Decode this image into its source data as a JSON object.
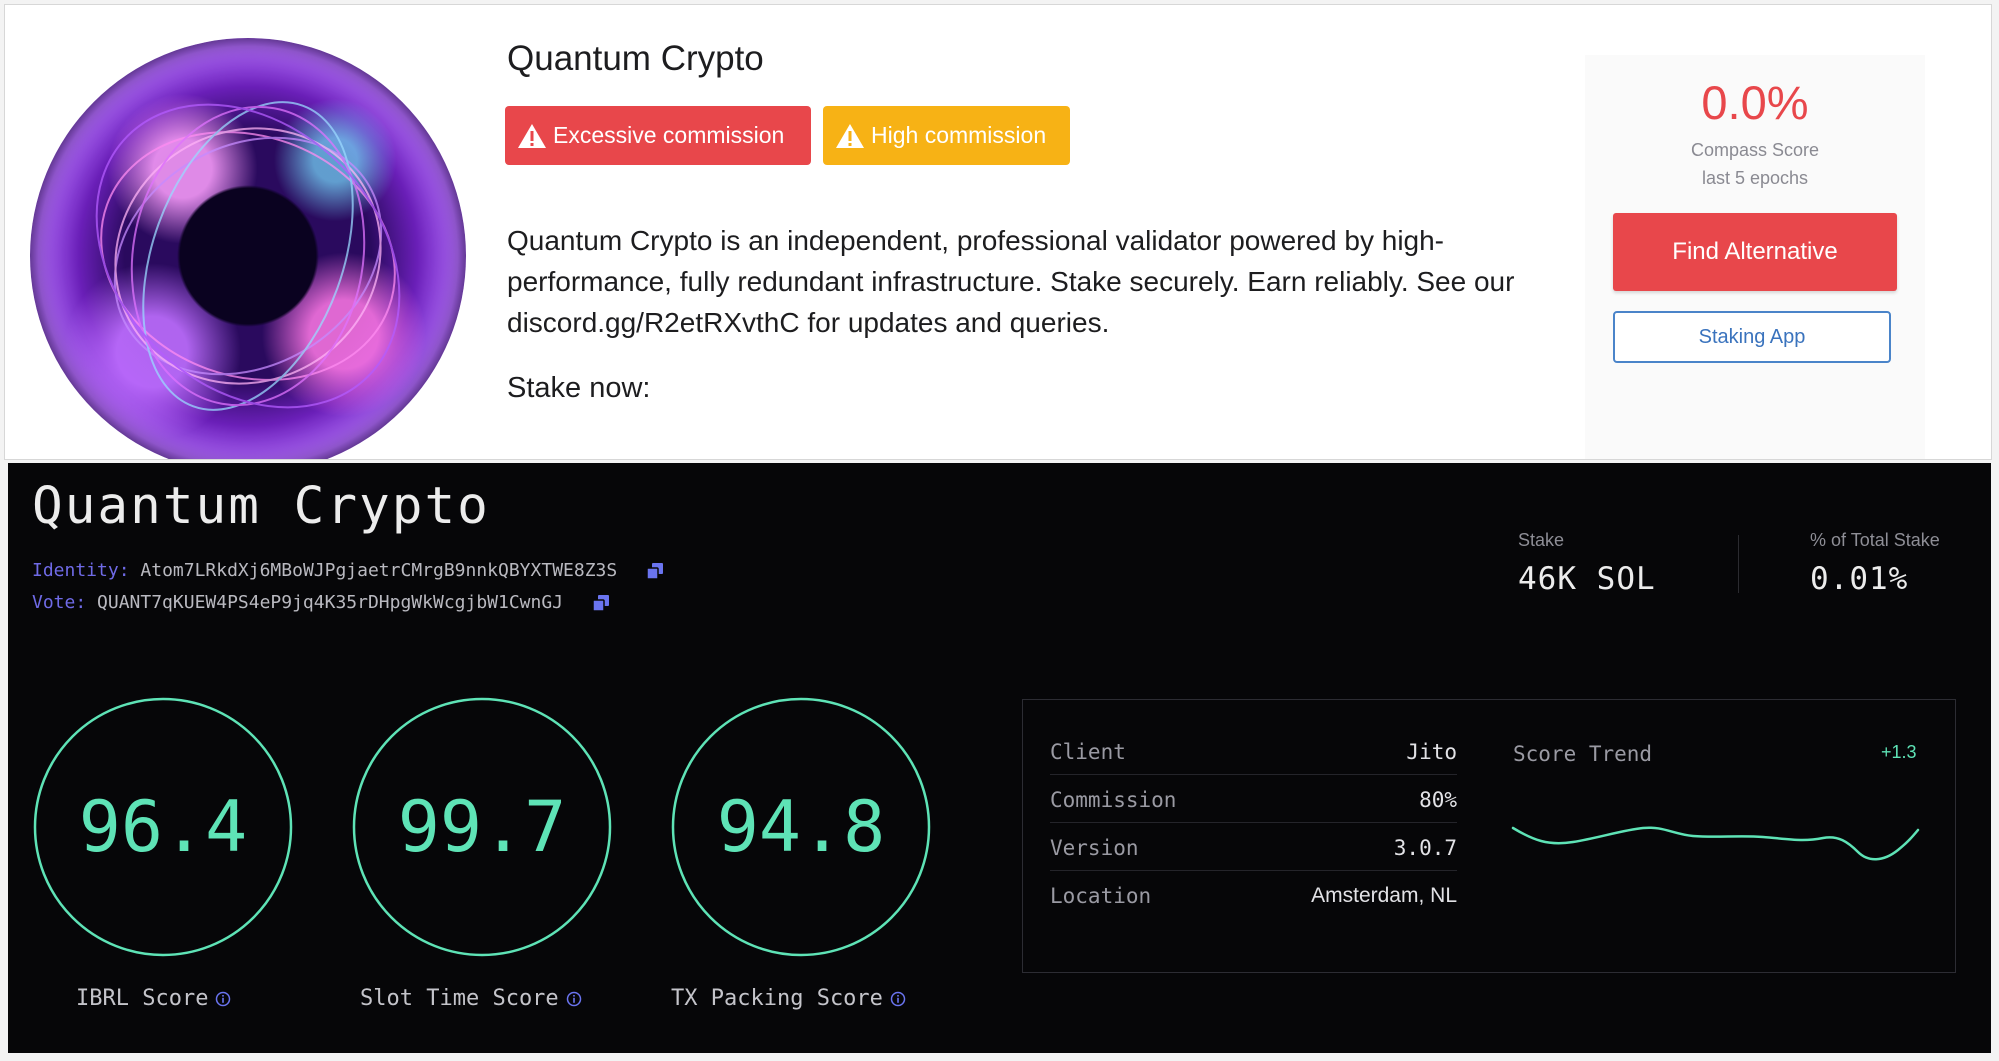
{
  "top": {
    "title": "Quantum Crypto",
    "badges": [
      {
        "label": "Excessive commission",
        "color": "#e8474b"
      },
      {
        "label": "High commission",
        "color": "#f7b215"
      }
    ],
    "description": "Quantum Crypto is an independent, professional validator powered by high-performance, fully redundant infrastructure. Stake securely. Earn reliably. See our discord.gg/R2etRXvthC for updates and queries.",
    "stake_now": "Stake now:",
    "compass_score": {
      "value": "0.0%",
      "label": "Compass Score",
      "sub": "last 5 epochs"
    },
    "find_alternative_label": "Find Alternative",
    "staking_app_label": "Staking App",
    "avatar_icon": "validator-logo-purple-orb"
  },
  "bottom": {
    "title": "Quantum Crypto",
    "identity": {
      "label": "Identity:",
      "value": "Atom7LRkdXj6MBoWJPgjaetrCMrgB9nnkQBYXTWE8Z3S"
    },
    "vote": {
      "label": "Vote:",
      "value": "QUANT7qKUEW4PS4eP9jq4K35rDHpgWkWcgjbW1CwnGJ"
    },
    "stats": {
      "stake": {
        "label": "Stake",
        "value": "46K SOL"
      },
      "total_stake": {
        "label": "% of Total Stake",
        "value": "0.01%"
      }
    },
    "scores": [
      {
        "label": "IBRL Score",
        "value": "96.4"
      },
      {
        "label": "Slot Time Score",
        "value": "99.7"
      },
      {
        "label": "TX Packing Score",
        "value": "94.8"
      }
    ],
    "info": [
      {
        "key": "Client",
        "value": "Jito"
      },
      {
        "key": "Commission",
        "value": "80%"
      },
      {
        "key": "Version",
        "value": "3.0.7"
      },
      {
        "key": "Location",
        "value": "Amsterdam, NL"
      }
    ],
    "trend": {
      "title": "Score Trend",
      "delta": "+1.3"
    },
    "accent_color": "#5ee3b6",
    "label_color": "#6f6ae6"
  }
}
